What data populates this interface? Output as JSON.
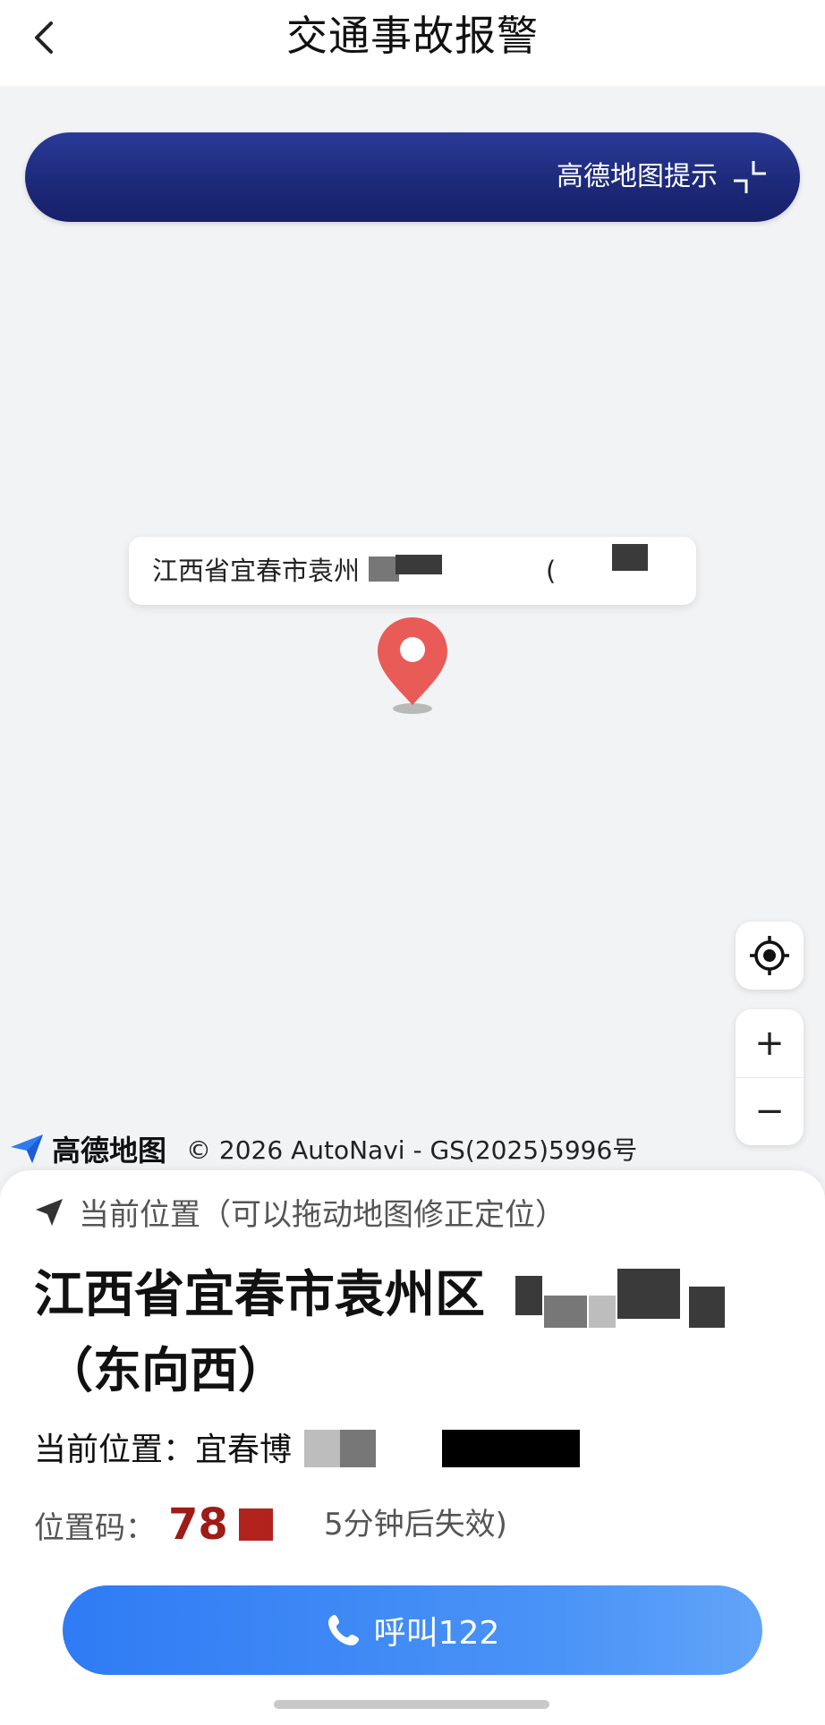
{
  "header": {
    "title": "交通事故报警",
    "back_icon": "chevron-left-icon"
  },
  "map": {
    "banner_text": "高德地图提示",
    "banner_icon": "collapse-icon",
    "bubble_address": "江西省宜春市袁州",
    "bubble_paren": "(",
    "pin_color": "#e95b57",
    "locate_icon": "crosshair-icon",
    "zoom_in_label": "+",
    "zoom_out_label": "−",
    "logo_text": "高德地图",
    "copyright": "© 2026 AutoNavi - GS(2025)5996号"
  },
  "sheet": {
    "hint_text": "当前位置（可以拖动地图修正定位）",
    "address_main": "江西省宜春市袁州区",
    "direction": "（东向西）",
    "current_label": "当前位置：宜春博",
    "code_label": "位置码：",
    "code_value": "78",
    "code_expire": "5分钟后失效)",
    "call_label": "呼叫122",
    "accent_color": "#2f7bf4",
    "code_color": "#9e1b17"
  }
}
